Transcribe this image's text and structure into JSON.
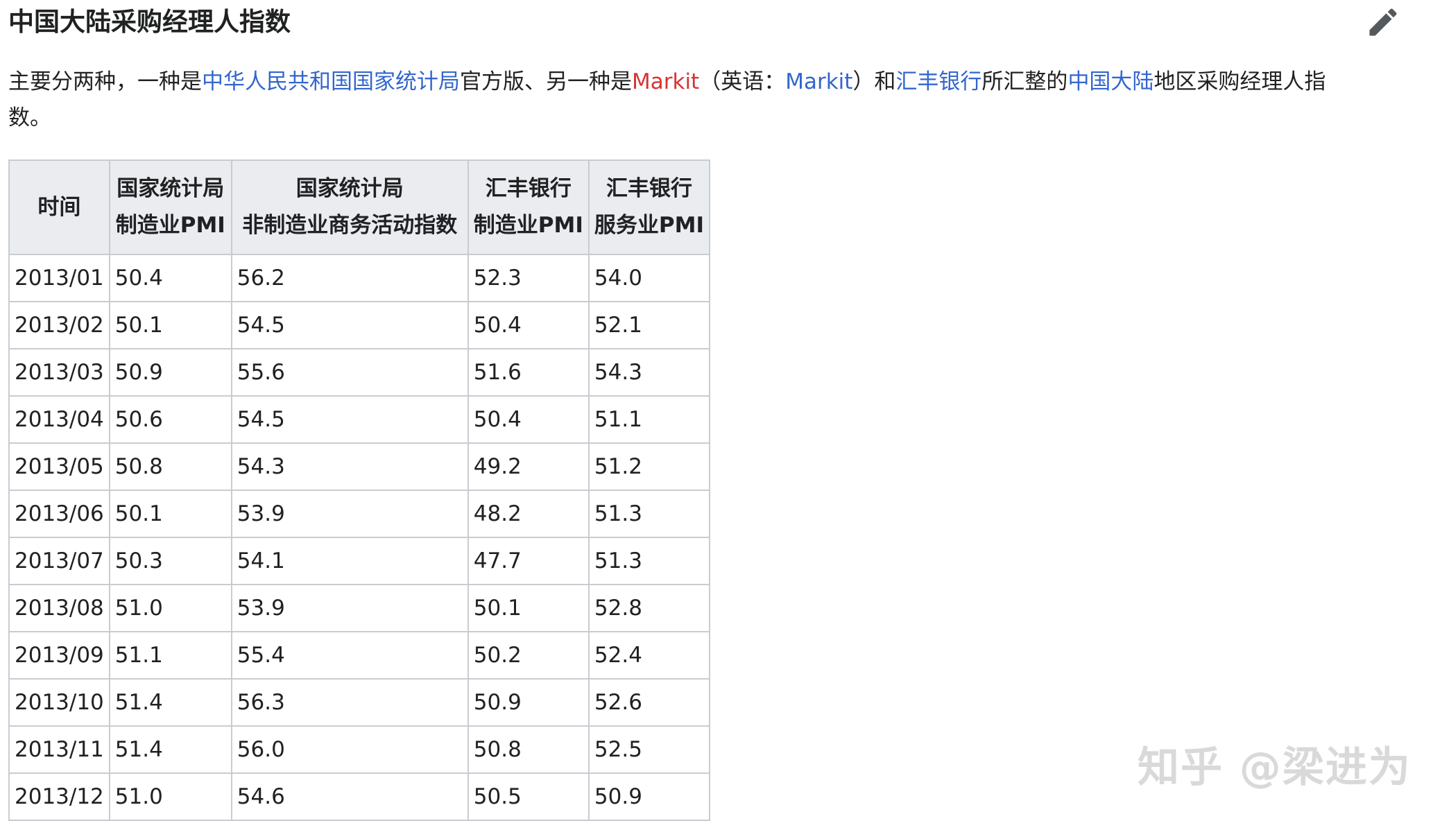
{
  "section": {
    "title": "中国大陆采购经理人指数"
  },
  "intro": {
    "text1": "主要分两种，一种是",
    "link_nbs": "中华人民共和国国家统计局",
    "text2": "官方版、另一种是",
    "link_markit_red": "Markit",
    "text3": "（英语：",
    "link_markit": "Markit",
    "text4": "）和",
    "link_hsbc": "汇丰银行",
    "text5": "所汇整的",
    "link_mainland": "中国大陆",
    "text6": "地区采购经理人指",
    "text7": "数。"
  },
  "table": {
    "headers": [
      {
        "lines": [
          "时间"
        ]
      },
      {
        "lines": [
          "国家统计局",
          "制造业PMI"
        ]
      },
      {
        "lines": [
          "国家统计局",
          "非制造业商务活动指数"
        ]
      },
      {
        "lines": [
          "汇丰银行",
          "制造业PMI"
        ]
      },
      {
        "lines": [
          "汇丰银行",
          "服务业PMI"
        ]
      }
    ],
    "rows": [
      [
        "2013/01",
        "50.4",
        "56.2",
        "52.3",
        "54.0"
      ],
      [
        "2013/02",
        "50.1",
        "54.5",
        "50.4",
        "52.1"
      ],
      [
        "2013/03",
        "50.9",
        "55.6",
        "51.6",
        "54.3"
      ],
      [
        "2013/04",
        "50.6",
        "54.5",
        "50.4",
        "51.1"
      ],
      [
        "2013/05",
        "50.8",
        "54.3",
        "49.2",
        "51.2"
      ],
      [
        "2013/06",
        "50.1",
        "53.9",
        "48.2",
        "51.3"
      ],
      [
        "2013/07",
        "50.3",
        "54.1",
        "47.7",
        "51.3"
      ],
      [
        "2013/08",
        "51.0",
        "53.9",
        "50.1",
        "52.8"
      ],
      [
        "2013/09",
        "51.1",
        "55.4",
        "50.2",
        "52.4"
      ],
      [
        "2013/10",
        "51.4",
        "56.3",
        "50.9",
        "52.6"
      ],
      [
        "2013/11",
        "51.4",
        "56.0",
        "50.8",
        "52.5"
      ],
      [
        "2013/12",
        "51.0",
        "54.6",
        "50.5",
        "50.9"
      ]
    ]
  },
  "icons": {
    "edit": "pencil-icon"
  },
  "watermark": {
    "text": "知乎 @梁进为"
  },
  "colors": {
    "link": "#3366cc",
    "new_link": "#d73333",
    "header_bg": "#eaecf0",
    "border": "#c8ccd1"
  }
}
